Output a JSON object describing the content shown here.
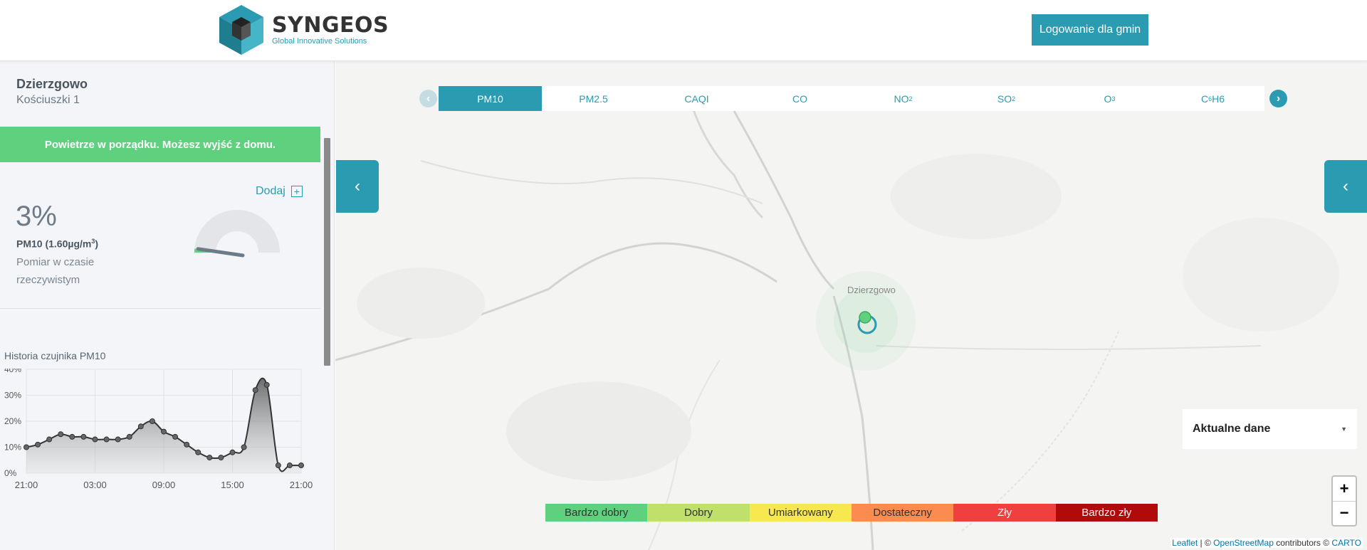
{
  "header": {
    "logo_name": "SYNGEOS",
    "logo_tagline": "Global Innovative Solutions",
    "login_label": "Logowanie dla gmin"
  },
  "sidebar": {
    "location_name": "Dzierzgowo",
    "location_address": "Kościuszki 1",
    "status_banner": "Powietrze w porządku. Możesz wyjść z domu.",
    "add_label": "Dodaj",
    "percent": "3%",
    "pm_label": "PM10 (1.60µg/m",
    "pm_unit_exp": "3",
    "pm_close": ")",
    "measurement_note": "Pomiar w czasie rzeczywistym",
    "gauge_fraction": 0.03,
    "history_title": "Historia czujnika PM10"
  },
  "chart_data": {
    "type": "area",
    "title": "Historia czujnika PM10",
    "x_tick_labels": [
      "21:00",
      "03:00",
      "09:00",
      "15:00",
      "21:00"
    ],
    "y_tick_labels": [
      "0%",
      "10%",
      "20%",
      "30%",
      "40%"
    ],
    "ylim": [
      0,
      40
    ],
    "x_hours_from_start": [
      0,
      1,
      2,
      3,
      4,
      5,
      6,
      7,
      8,
      9,
      10,
      11,
      12,
      13,
      14,
      15,
      16,
      17,
      18,
      19,
      20,
      21,
      22,
      23,
      24
    ],
    "values": [
      10,
      11,
      13,
      15,
      14,
      14,
      13,
      13,
      13,
      14,
      18,
      20,
      16,
      14,
      11,
      8,
      6,
      6,
      8,
      10,
      32,
      34,
      3,
      3,
      3
    ],
    "grid": true
  },
  "map": {
    "tabs": [
      {
        "label": "PM10",
        "sub": "",
        "tail": "",
        "active": true
      },
      {
        "label": "PM2.5",
        "sub": "",
        "tail": "",
        "active": false
      },
      {
        "label": "CAQI",
        "sub": "",
        "tail": "",
        "active": false
      },
      {
        "label": "CO",
        "sub": "",
        "tail": "",
        "active": false
      },
      {
        "label": "NO",
        "sub": "2",
        "tail": "",
        "active": false
      },
      {
        "label": "SO",
        "sub": "2",
        "tail": "",
        "active": false
      },
      {
        "label": "O",
        "sub": "3",
        "tail": "",
        "active": false
      },
      {
        "label": "C",
        "sub": "6",
        "tail": "H6",
        "active": false
      }
    ],
    "town_label": "Dzierzgowo",
    "data_select": "Aktualne dane",
    "legend": [
      {
        "label": "Bardzo dobry",
        "color": "#5ed07e"
      },
      {
        "label": "Dobry",
        "color": "#bfe06a"
      },
      {
        "label": "Umiarkowany",
        "color": "#f7e84f"
      },
      {
        "label": "Dostateczny",
        "color": "#fb8b4e"
      },
      {
        "label": "Zły",
        "color": "#ef3f3f"
      },
      {
        "label": "Bardzo zły",
        "color": "#b10a0a"
      }
    ],
    "zoom_in": "+",
    "zoom_out": "−",
    "attribution": {
      "leaflet": "Leaflet",
      "sep": " | © ",
      "osm": "OpenStreetMap",
      "contrib": " contributors © ",
      "carto": "CARTO"
    }
  },
  "colors": {
    "accent": "#2a9bb0",
    "good": "#5ed07e"
  }
}
